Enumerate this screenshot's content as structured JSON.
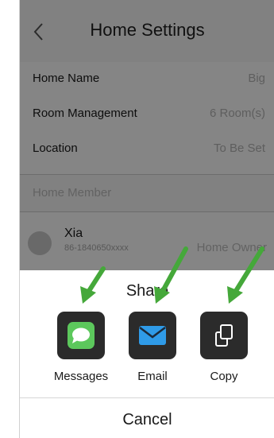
{
  "header": {
    "title": "Home Settings",
    "back_icon": "chevron-left-icon"
  },
  "home_info": {
    "rows": [
      {
        "label": "Home Name",
        "value": "Big"
      },
      {
        "label": "Room Management",
        "value": "6 Room(s)"
      },
      {
        "label": "Location",
        "value": "To Be Set"
      }
    ]
  },
  "members": {
    "section_title": "Home Member",
    "items": [
      {
        "name": "Xia",
        "phone": "86-1840650xxxx",
        "role": "Home Owner"
      }
    ]
  },
  "share_sheet": {
    "title": "Share",
    "options": [
      {
        "label": "Messages",
        "icon": "messages-icon",
        "color": "#5cc85c"
      },
      {
        "label": "Email",
        "icon": "email-icon",
        "color": "#2f9be8"
      },
      {
        "label": "Copy",
        "icon": "copy-icon",
        "color": "#ffffff"
      }
    ],
    "cancel_label": "Cancel"
  },
  "colors": {
    "overlay": "rgba(0,0,0,0.48)",
    "pointer_arrows": "#45a83a"
  }
}
